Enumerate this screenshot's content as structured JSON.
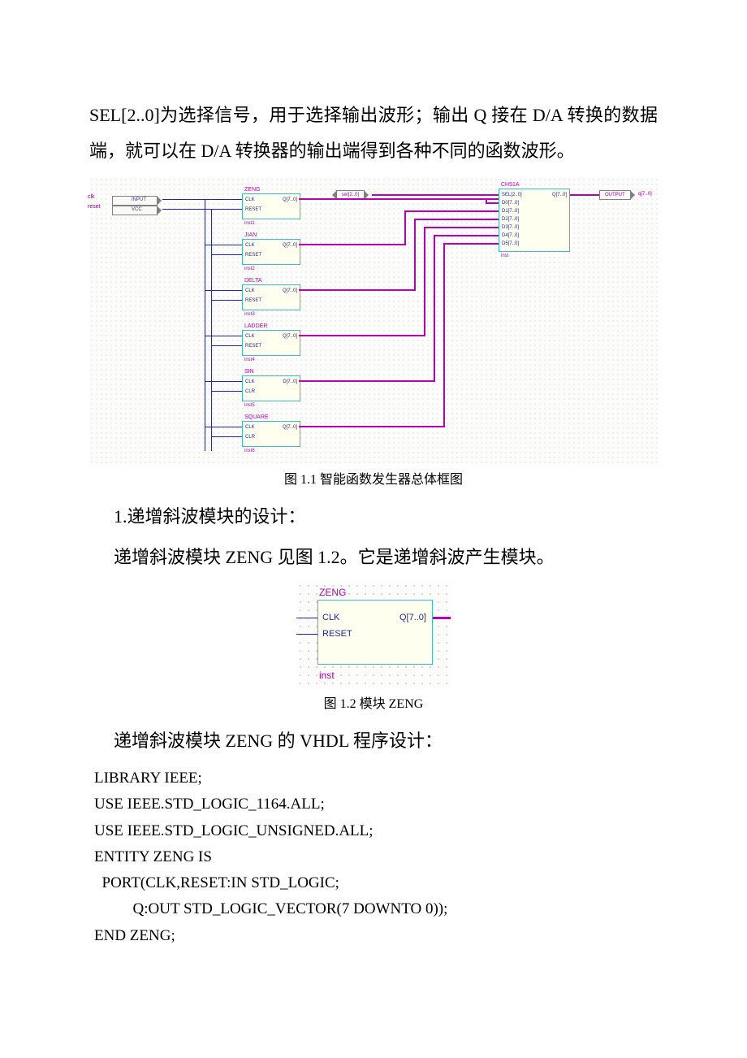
{
  "para1": "SEL[2..0]为选择信号，用于选择输出波形；输出 Q 接在 D/A 转换的数据端，就可以在 D/A 转换器的输出端得到各种不同的函数波形。",
  "fig11": {
    "caption": "图 1.1    智能函数发生器总体框图",
    "inputs": {
      "clk": {
        "label": "clk",
        "tag": "INPUT"
      },
      "reset": {
        "label": "reset",
        "tag": "VCC"
      }
    },
    "sel_tag": "sel[2..0]",
    "output_pin": "OUTPUT",
    "output_label": "q[7..0]",
    "blocks": [
      {
        "name": "ZENG",
        "inst": "inst1",
        "ports_l": [
          "CLK",
          "RESET"
        ],
        "port_r": "Q[7..0]"
      },
      {
        "name": "JIAN",
        "inst": "inst2",
        "ports_l": [
          "CLK",
          "RESET"
        ],
        "port_r": "Q[7..0]"
      },
      {
        "name": "DELTA",
        "inst": "inst3",
        "ports_l": [
          "CLK",
          "RESET"
        ],
        "port_r": "Q[7..0]"
      },
      {
        "name": "LADDER",
        "inst": "inst4",
        "ports_l": [
          "CLK",
          "RESET"
        ],
        "port_r": "Q[7..0]"
      },
      {
        "name": "SIN",
        "inst": "inst5",
        "ports_l": [
          "CLK",
          "CLR"
        ],
        "port_r": "D[7..0]"
      },
      {
        "name": "SQUARE",
        "inst": "inst6",
        "ports_l": [
          "CLK",
          "CLR"
        ],
        "port_r": "Q[7..0]"
      }
    ],
    "mux": {
      "name": "CH51A",
      "inst": "inst",
      "port_r": "Q[7..0]",
      "ports_l": [
        "SEL[2..0]",
        "D0[7..0]",
        "D1[7..0]",
        "D2[7..0]",
        "D3[7..0]",
        "D4[7..0]",
        "D5[7..0]"
      ]
    }
  },
  "heading1": "1.递增斜波模块的设计：",
  "para2": "递增斜波模块 ZENG 见图 1.2。它是递增斜波产生模块。",
  "fig12": {
    "caption": "图 1.2    模块 ZENG",
    "name": "ZENG",
    "inst": "inst",
    "ports_l": [
      "CLK",
      "RESET"
    ],
    "port_r": "Q[7..0]"
  },
  "para3": "递增斜波模块 ZENG 的 VHDL 程序设计：",
  "code": "LIBRARY IEEE;\nUSE IEEE.STD_LOGIC_1164.ALL;\nUSE IEEE.STD_LOGIC_UNSIGNED.ALL;\nENTITY ZENG IS\n  PORT(CLK,RESET:IN STD_LOGIC;\n          Q:OUT STD_LOGIC_VECTOR(7 DOWNTO 0));\nEND ZENG;"
}
